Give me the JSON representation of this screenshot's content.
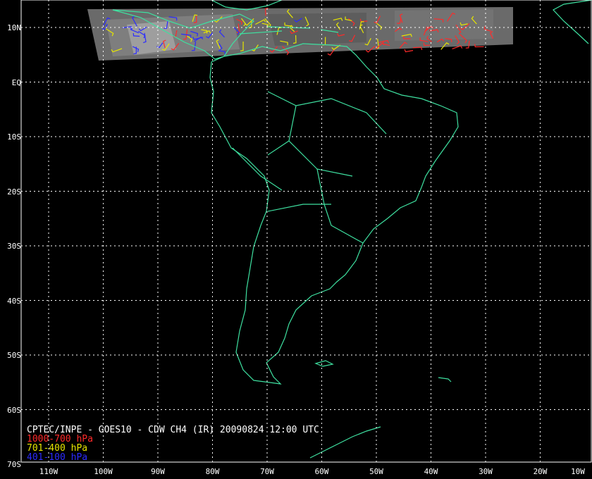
{
  "map": {
    "title": "CPTEC/INPE - GOES10 - CDW CH4 (IR) 20090824 12:00 UTC",
    "legend": [
      {
        "label": "1000-700 hPa",
        "color": "#ff2a2a"
      },
      {
        "label": "701-400 hPa",
        "color": "#e6e600"
      },
      {
        "label": "401-100 hPa",
        "color": "#2b2bff"
      }
    ],
    "lat_labels": [
      "10N",
      "EQ",
      "10S",
      "20S",
      "30S",
      "40S",
      "50S",
      "60S",
      "70S"
    ],
    "lon_labels": [
      "110W",
      "100W",
      "90W",
      "80W",
      "70W",
      "60W",
      "50W",
      "40W",
      "30W",
      "20W",
      "10W"
    ],
    "coast_color": "#3ee0a0",
    "grid_color": "#ffffff",
    "background_color": "#000000"
  }
}
